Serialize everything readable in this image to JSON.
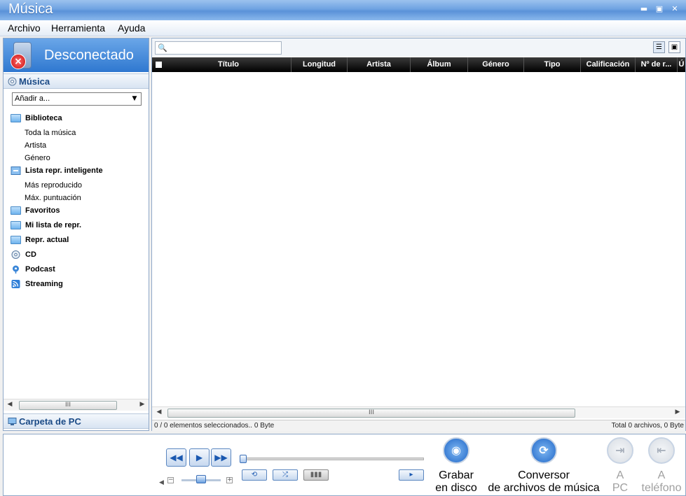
{
  "window": {
    "title": "Música",
    "minimize": "▬",
    "maximize": "▣",
    "close": "✕"
  },
  "menu": [
    "Archivo",
    "Herramienta",
    "Ayuda"
  ],
  "device": {
    "status": "Desconectado"
  },
  "music_section": {
    "title": "Música",
    "add_to": "Añadir a..."
  },
  "tree": {
    "biblioteca": "Biblioteca",
    "toda": "Toda la música",
    "artista": "Artista",
    "genero": "Género",
    "inteligente": "Lista repr. inteligente",
    "mas_reproducido": "Más reproducido",
    "max_puntuacion": "Máx. puntuación",
    "favoritos": "Favoritos",
    "mi_lista": "Mi lista de repr.",
    "actual": "Repr. actual",
    "cd": "CD",
    "podcast": "Podcast",
    "streaming": "Streaming"
  },
  "pc_section": {
    "title": "Carpeta de PC"
  },
  "columns": [
    "Título",
    "Longitud",
    "Artista",
    "Álbum",
    "Género",
    "Tipo",
    "Calificación",
    "Nº de r...",
    "Ú"
  ],
  "status": {
    "selected": "0 / 0 elementos seleccionados.. 0 Byte",
    "total": "Total 0 archivos, 0 Byte"
  },
  "player": {
    "prev": "◀◀",
    "play": "▶",
    "next": "▶▶",
    "repeat": "⟲",
    "shuffle": "⤮",
    "eq": "▮▮▮",
    "vol_minus": "−",
    "vol_plus": "+",
    "arrow": "▸"
  },
  "actions": {
    "burn": {
      "l1": "Grabar",
      "l2": "en disco"
    },
    "convert": {
      "l1": "Conversor",
      "l2": "de archivos de música"
    },
    "to_pc": {
      "l1": "A",
      "l2": "PC"
    },
    "to_phone": {
      "l1": "A",
      "l2": "teléfono"
    }
  },
  "scroll_grip": "III"
}
